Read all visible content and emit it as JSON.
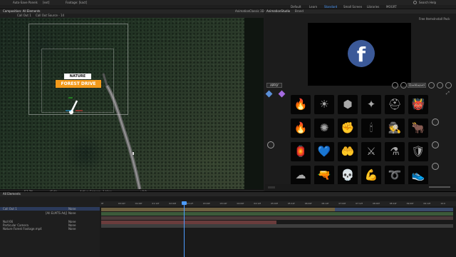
{
  "menubar": {
    "left_items": [
      "Auto-Save Panels"
    ],
    "middle_items": [
      "[ext]",
      "Footage: [kact]"
    ],
    "search_label": "Search Help"
  },
  "workspaces": {
    "items": [
      "Default",
      "Learn",
      "Standard",
      "Small Screen",
      "Libraries",
      "MOGRT"
    ],
    "active": "Standard"
  },
  "comp_panel": {
    "tab_label": "Composition: All Elements",
    "crumbs": [
      "Call Out 1",
      "Call Out Source - 14"
    ],
    "right_tabs": [
      "Animation",
      "Classic 3D"
    ],
    "title_top": "NATURE",
    "title_main": "FOREST DRIVE",
    "controls": [
      "57.7%",
      "(Full)",
      "Active Camera",
      "1 View",
      "+0.0"
    ]
  },
  "right_panel": {
    "tabs": [
      "AnimationStudio",
      "Brand"
    ],
    "header_links": [
      "Free Items",
      "Install Pack"
    ],
    "preview_icon": "facebook-logo",
    "preview_glyph": "f",
    "apply_label": "APPLY",
    "dashboard_label": "Dashboard"
  },
  "icon_grid": {
    "icons": [
      {
        "name": "fire-bowl-icon",
        "glyph": "🔥"
      },
      {
        "name": "sun-burst-icon",
        "glyph": "☀"
      },
      {
        "name": "red-gem-icon",
        "glyph": "⬢"
      },
      {
        "name": "stars-icon",
        "glyph": "✦"
      },
      {
        "name": "helmet-icon",
        "glyph": "⛑"
      },
      {
        "name": "demon-icon",
        "glyph": "👹"
      },
      {
        "name": "flame-icon",
        "glyph": "🔥"
      },
      {
        "name": "blue-spark-icon",
        "glyph": "✺"
      },
      {
        "name": "fire-fist-icon",
        "glyph": "✊"
      },
      {
        "name": "torch-icon",
        "glyph": "🕯"
      },
      {
        "name": "detective-icon",
        "glyph": "🕵"
      },
      {
        "name": "bull-icon",
        "glyph": "🐂"
      },
      {
        "name": "lantern-icon",
        "glyph": "🏮"
      },
      {
        "name": "heart-hand-icon",
        "glyph": "💙"
      },
      {
        "name": "hand-fire-icon",
        "glyph": "🤲"
      },
      {
        "name": "crossed-swords-icon",
        "glyph": "⚔"
      },
      {
        "name": "potion-icon",
        "glyph": "⚗"
      },
      {
        "name": "shield-icon",
        "glyph": "🛡"
      },
      {
        "name": "mushroom-cloud-icon",
        "glyph": "☁"
      },
      {
        "name": "gun-icon",
        "glyph": "🔫"
      },
      {
        "name": "skull-icon",
        "glyph": "💀"
      },
      {
        "name": "arm-icon",
        "glyph": "💪"
      },
      {
        "name": "rope-icon",
        "glyph": "➰"
      },
      {
        "name": "sneaker-icon",
        "glyph": "👟"
      }
    ]
  },
  "timeline": {
    "tab_label": "All Elements",
    "layers": [
      {
        "name": "Call Out 1",
        "mode": "None"
      },
      {
        "name": "[All ELMTS Adj]",
        "mode": "None"
      },
      {
        "name": "Null 66",
        "mode": "None"
      },
      {
        "name": "Particular Camera",
        "mode": "None"
      },
      {
        "name": "Nature Forest Footage.mp4",
        "mode": "None"
      }
    ],
    "ruler_ticks": [
      "0f",
      "00:12f",
      "01:00f",
      "01:12f",
      "02:00f",
      "02:12f",
      "03:00f",
      "03:12f",
      "04:00f",
      "04:12f",
      "05:00f",
      "05:12f",
      "06:00f",
      "06:12f",
      "07:00f",
      "07:12f",
      "08:00f",
      "08:12f",
      "09:00f",
      "09:12f",
      "10:0"
    ]
  },
  "colors": {
    "accent": "#4d9cff",
    "orange": "#f39a1b",
    "facebook": "#3b5998"
  }
}
